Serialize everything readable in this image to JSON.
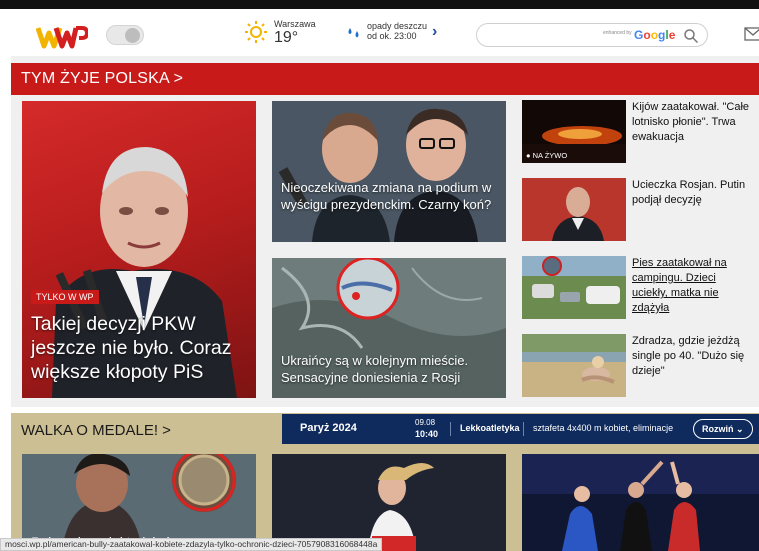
{
  "header": {
    "logo_alt": "WP",
    "weather": {
      "city": "Warszawa",
      "temperature": "19°",
      "precip_line1": "opady deszczu",
      "precip_line2": "od ok. 23:00"
    },
    "search": {
      "placeholder": "",
      "powered_by": "enhanced by",
      "google_label": "Google"
    }
  },
  "section_polska": {
    "title": "TYM ŻYJE POLSKA >",
    "main_story": {
      "badge": "TYLKO W WP",
      "headline": "Takiej decyzji PKW jeszcze nie było. Coraz większe kłopoty PiS"
    },
    "mid_stories": [
      {
        "headline": "Nieoczekiwana zmiana na podium w wyścigu prezydenckim. Czarny koń?"
      },
      {
        "headline": "Ukraińcy są w kolejnym mieście. Sensacyjne doniesienia z Rosji"
      }
    ],
    "side_stories": [
      {
        "headline": "Kijów zaatakował. \"Całe lotnisko płonie\". Trwa ewakuacja",
        "label": "● NA ŻYWO"
      },
      {
        "headline": "Ucieczka Rosjan. Putin podjął decyzję"
      },
      {
        "headline": "Pies zaatakował na campingu. Dzieci uciekły, matka nie zdążyła"
      },
      {
        "headline": "Zdradza, gdzie jeżdżą single po 40. \"Dużo się dzieje\""
      }
    ]
  },
  "section_medale": {
    "title": "WALKA O MEDALE! >",
    "olympics_bar": {
      "event": "Paryż 2024",
      "date": "09.08",
      "time": "10:40",
      "sport": "Lekkoatletyka",
      "competition": "sztafeta 4x400 m kobiet, eliminacje",
      "expand_label": "Rozwiń ⌄"
    },
    "tiles": [
      {
        "caption": "Pokazał medal tydzień po"
      },
      {
        "caption": ""
      },
      {
        "caption": ""
      }
    ]
  },
  "status_url": "mosci.wp.pl/american-bully-zaatakowal-kobiete-zdazyla-tylko-ochronic-dzieci-7057908316068448a",
  "colors": {
    "brand_red": "#c91a1a",
    "olympics_navy": "#0f2a5c",
    "medal_section_bg": "#cdbf94"
  }
}
